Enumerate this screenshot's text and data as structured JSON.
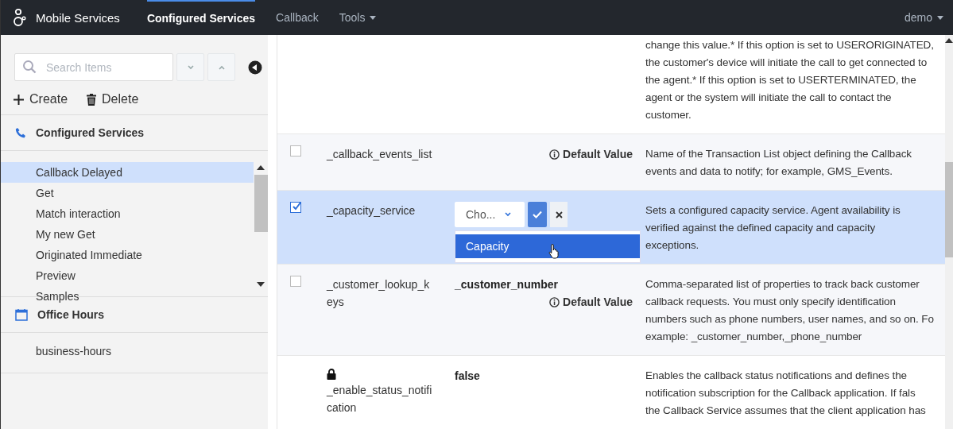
{
  "header": {
    "app_title": "Mobile Services",
    "nav": [
      {
        "label": "Configured Services",
        "selected": true,
        "kind": "link"
      },
      {
        "label": "Callback",
        "selected": false,
        "kind": "link"
      },
      {
        "label": "Tools",
        "selected": false,
        "kind": "menu"
      }
    ],
    "user": "demo"
  },
  "sidebar": {
    "search": {
      "placeholder": "Search Items"
    },
    "create": "Create",
    "delete": "Delete",
    "sections": [
      {
        "title": "Configured Services",
        "items": [
          {
            "label": "Callback Delayed",
            "selected": true
          },
          {
            "label": "Get",
            "selected": false
          },
          {
            "label": "Match interaction",
            "selected": false
          },
          {
            "label": "My new Get",
            "selected": false
          },
          {
            "label": "Originated Immediate",
            "selected": false
          },
          {
            "label": "Preview",
            "selected": false
          },
          {
            "label": "Samples",
            "selected": false
          }
        ]
      },
      {
        "title": "Office Hours",
        "items": [
          {
            "label": "business-hours",
            "selected": false
          }
        ]
      }
    ]
  },
  "table": {
    "rows": [
      {
        "kind": "continued",
        "selected": false,
        "description": [
          "change this value.* If this option is set to USERORIGINATED,",
          "the customer's device will initiate the call to get connected to",
          "the agent.* If this option is set to USERTERMINATED, the",
          "agent or the system will initiate the call to contact the",
          "customer."
        ]
      },
      {
        "kind": "option",
        "selected": false,
        "checked": false,
        "name": [
          "_callback_events_list"
        ],
        "default_label": "Default Value",
        "description": [
          "Name of the Transaction List object defining the Callback",
          "events and data to notify; for example, GMS_Events."
        ]
      },
      {
        "kind": "editing",
        "selected": true,
        "checked": true,
        "name": [
          "_capacity_service"
        ],
        "editor": {
          "value": "Cho...",
          "options": [
            {
              "label": "Capacity",
              "selected": true
            }
          ]
        },
        "description": [
          "Sets a configured capacity service. Agent availability is",
          "verified against the defined capacity and capacity",
          "exceptions."
        ]
      },
      {
        "kind": "option",
        "selected": false,
        "checked": false,
        "name": [
          "_customer_lookup_k",
          "eys"
        ],
        "value": "_customer_number",
        "default_label": "Default Value",
        "description": [
          "Comma-separated list of properties to track back customer",
          "callback requests. You must only specify identification",
          "numbers such as phone numbers, user names, and so on. Fo",
          "example: _customer_number,_phone_number"
        ]
      },
      {
        "kind": "locked",
        "selected": false,
        "name": [
          "_enable_status_notifi",
          "cation"
        ],
        "value": "false",
        "description": [
          "Enables the callback status notifications and defines the",
          "notification subscription for the Callback application. If fals",
          "the Callback Service assumes that the client application has"
        ]
      }
    ]
  }
}
